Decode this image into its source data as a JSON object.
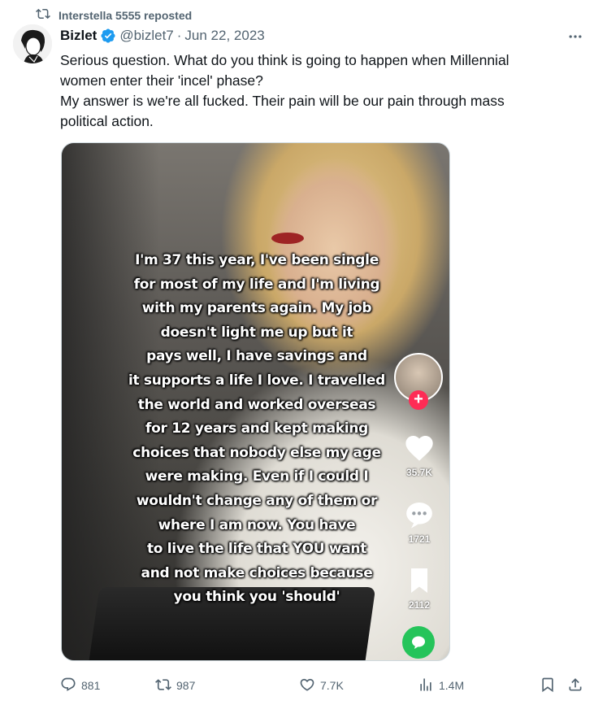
{
  "repost_banner": {
    "text": "Interstella 5555 reposted"
  },
  "tweet": {
    "display_name": "Bizlet",
    "handle": "@bizlet7",
    "separator": "·",
    "date": "Jun 22, 2023",
    "text_lines": [
      "Serious question. What do you think is going to happen when Millennial",
      "women enter their 'incel' phase?",
      "My answer is we're all fucked. Their pain will be our pain through mass",
      "political action."
    ]
  },
  "video": {
    "caption_lines": [
      "I'm 37 this year, I've been single",
      "for most of my life and I'm living",
      "with my parents again. My job",
      "doesn't light me up but it",
      "pays well, I have savings and",
      "it supports a life I love. I travelled",
      "the world and worked overseas",
      "for 12 years and kept making",
      "choices that nobody else my age",
      "were making. Even if I could I",
      "wouldn't change any of them or",
      "where I am now. You have",
      "to live the life that YOU want",
      "and not make choices because",
      "you think you 'should'"
    ],
    "likes": "35.7K",
    "comments": "1721",
    "saves": "2112"
  },
  "actions": {
    "replies": "881",
    "reposts": "987",
    "likes": "7.7K",
    "views": "1.4M"
  },
  "colors": {
    "verified": "#1d9bf0",
    "muted_text": "#536471",
    "tiktok_red": "#fe2c55",
    "message_green": "#25c45a"
  },
  "icons": [
    "repost-icon",
    "verified-badge-icon",
    "more-icon",
    "heart-icon",
    "comment-bubble-icon",
    "bookmark-icon",
    "plus-icon",
    "message-icon",
    "reply-icon",
    "like-icon",
    "views-icon",
    "share-icon"
  ]
}
